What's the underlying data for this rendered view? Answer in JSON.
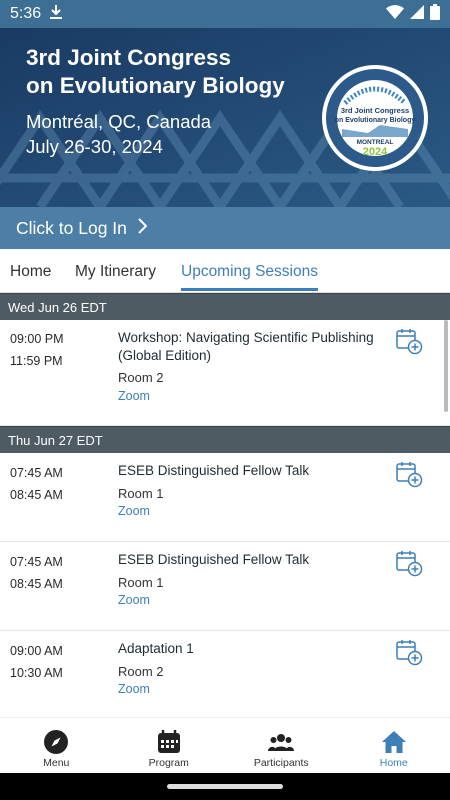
{
  "status_bar": {
    "time": "5:36"
  },
  "banner": {
    "title_line1": "3rd Joint Congress",
    "title_line2": "on Evolutionary Biology",
    "location": "Montréal, QC, Canada",
    "dates": "July 26-30, 2024",
    "seal_title1": "3rd Joint Congress",
    "seal_title2": "on Evolutionary Biology",
    "seal_city": "MONTREAL",
    "seal_year": "2024"
  },
  "login": {
    "label": "Click to Log In"
  },
  "tabs": [
    {
      "label": "Home"
    },
    {
      "label": "My Itinerary"
    },
    {
      "label": "Upcoming Sessions"
    }
  ],
  "days": [
    {
      "header": "Wed Jun 26 EDT",
      "sessions": [
        {
          "start": "09:00 PM",
          "end": "11:59 PM",
          "title": "Workshop: Navigating Scientific Publishing (Global Edition)",
          "room": "Room 2",
          "link": "Zoom"
        }
      ]
    },
    {
      "header": "Thu Jun 27 EDT",
      "sessions": [
        {
          "start": "07:45 AM",
          "end": "08:45 AM",
          "title": "ESEB Distinguished Fellow Talk",
          "room": "Room 1",
          "link": "Zoom"
        },
        {
          "start": "07:45 AM",
          "end": "08:45 AM",
          "title": "ESEB Distinguished Fellow Talk",
          "room": "Room 1",
          "link": "Zoom"
        },
        {
          "start": "09:00 AM",
          "end": "10:30 AM",
          "title": "Adaptation 1",
          "room": "Room 2",
          "link": "Zoom"
        }
      ]
    }
  ],
  "bottom_nav": [
    {
      "label": "Menu",
      "icon": "compass-icon"
    },
    {
      "label": "Program",
      "icon": "calendar-icon"
    },
    {
      "label": "Participants",
      "icon": "people-icon"
    },
    {
      "label": "Home",
      "icon": "home-icon",
      "active": true
    }
  ],
  "colors": {
    "accent": "#3d7fb8",
    "status_bar": "#3d6f94",
    "login_bar": "#4d7fa6",
    "day_header": "#4f5b63"
  }
}
